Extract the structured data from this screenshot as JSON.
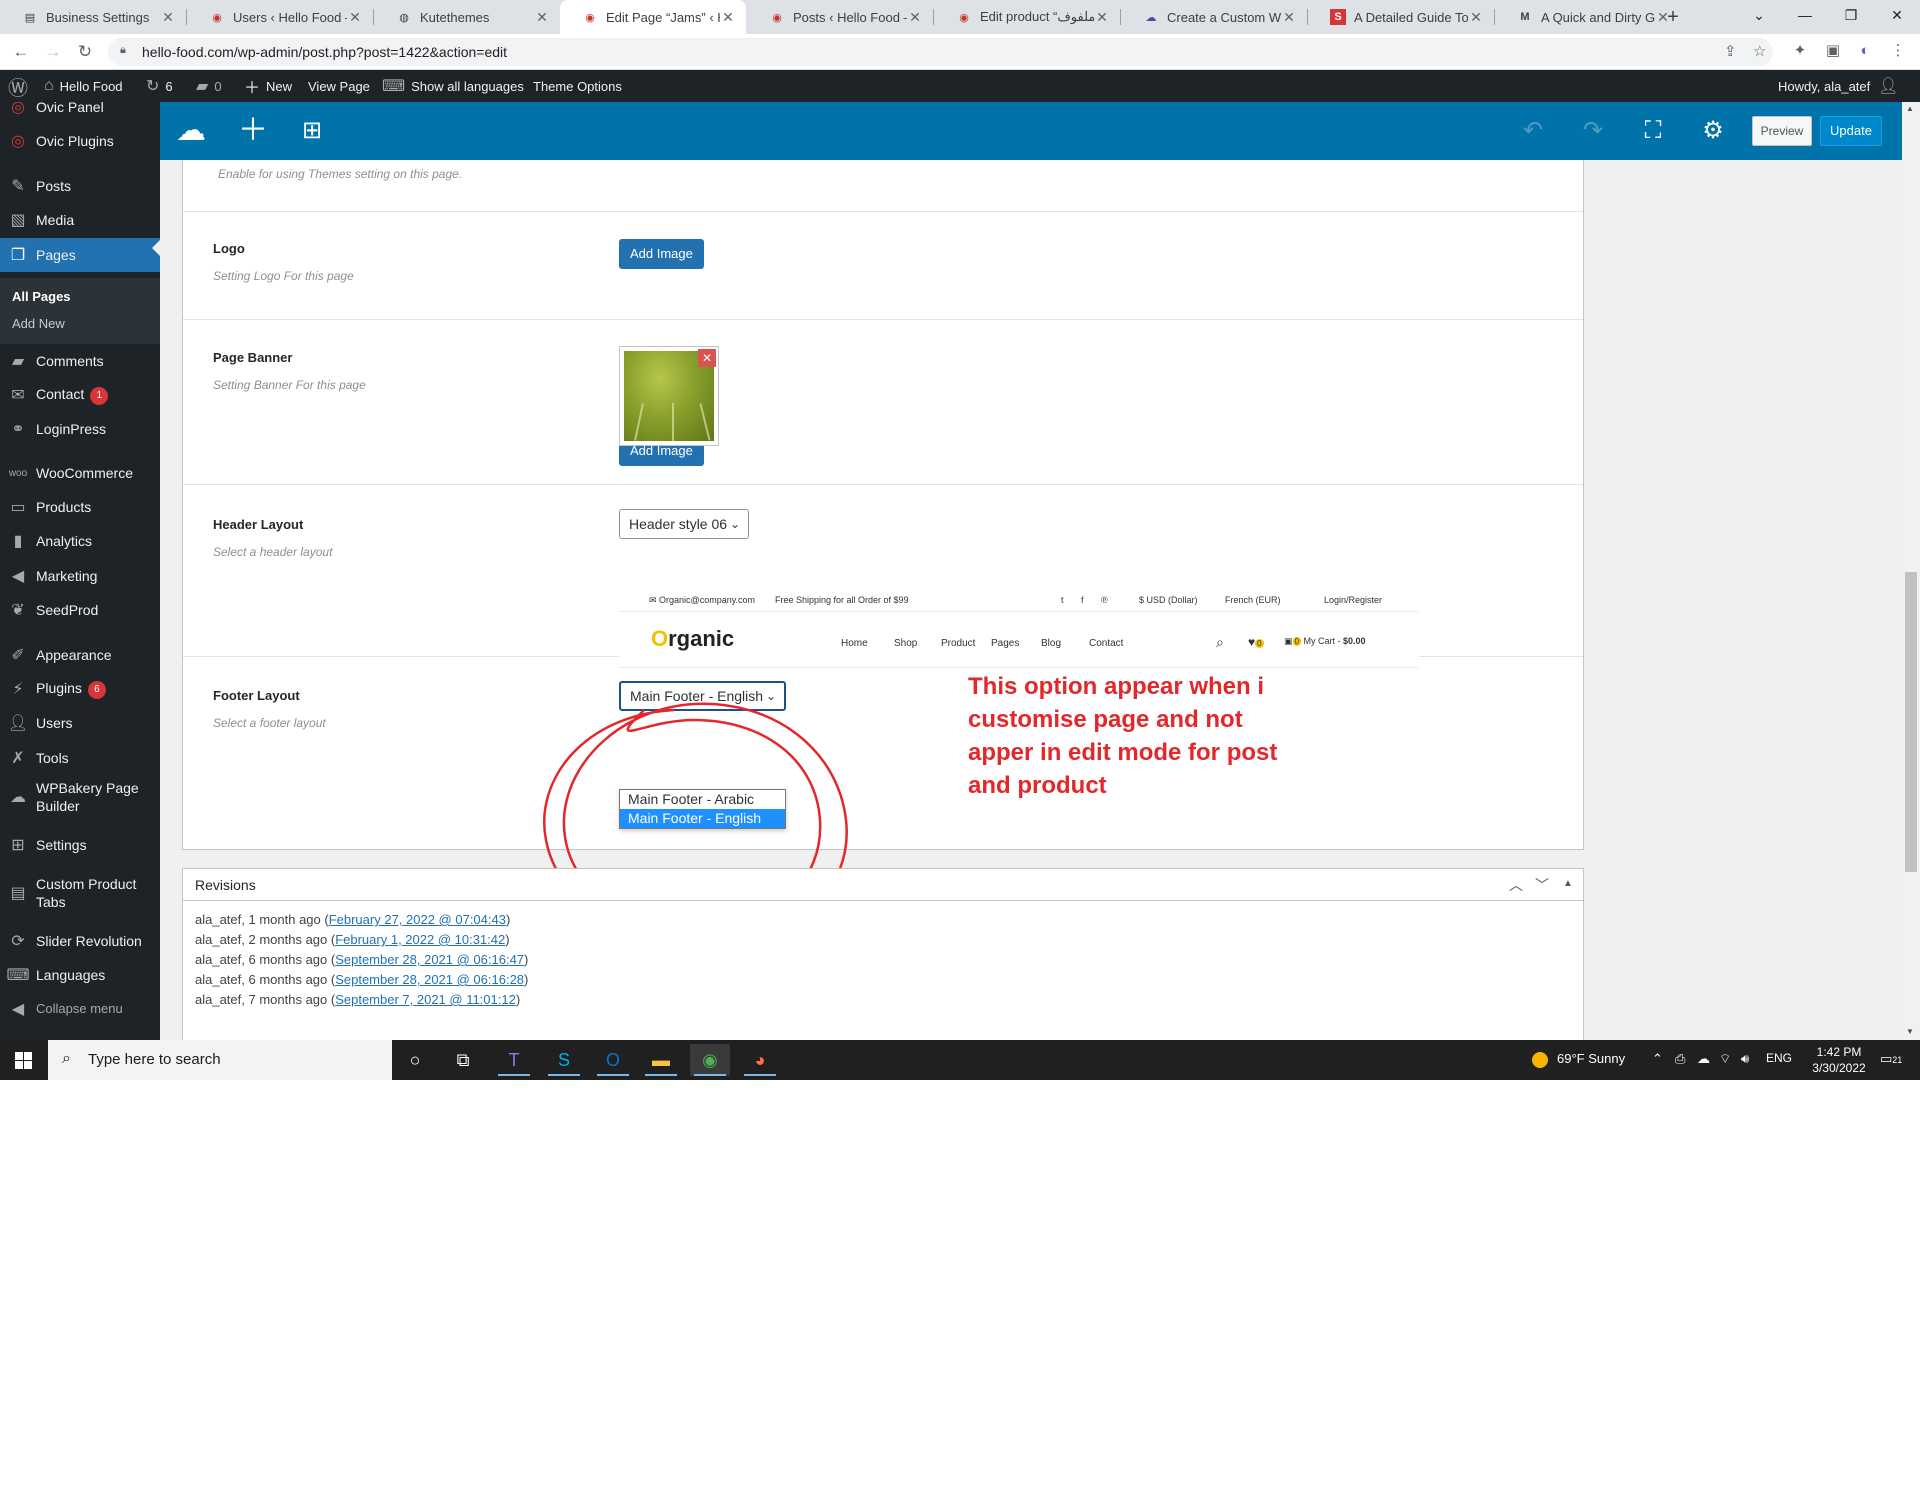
{
  "browser": {
    "tabs": [
      {
        "label": "Business Settings",
        "icon": "business-icon"
      },
      {
        "label": "Users ‹ Hello Food — WordPress",
        "icon": "wp-site-icon"
      },
      {
        "label": "Kutethemes",
        "icon": "globe-icon"
      },
      {
        "label": "Edit Page “Jams” ‹ Hello Food",
        "icon": "wp-site-icon",
        "active": true
      },
      {
        "label": "Posts ‹ Hello Food — WordPress",
        "icon": "wp-site-icon"
      },
      {
        "label": "Edit product “الملفوف”",
        "icon": "wp-site-icon"
      },
      {
        "label": "Create a Custom WordPress",
        "icon": "cloud-icon"
      },
      {
        "label": "A Detailed Guide To A",
        "icon": "s-icon"
      },
      {
        "label": "A Quick and Dirty Guide",
        "icon": "wm-icon"
      }
    ],
    "url": "hello-food.com/wp-admin/post.php?post=1422&action=edit"
  },
  "adminbar": {
    "site_name": "Hello Food",
    "updates": "6",
    "comments": "0",
    "new": "New",
    "view_page": "View Page",
    "languages": "Show all languages",
    "theme_options": "Theme Options",
    "howdy": "Howdy, ala_atef"
  },
  "menu": {
    "items": [
      {
        "label": "Ovic Panel",
        "icon": "ovic-icon"
      },
      {
        "label": "Ovic Plugins",
        "icon": "ovic-icon"
      },
      {
        "label": "Posts",
        "icon": "pin-icon"
      },
      {
        "label": "Media",
        "icon": "media-icon"
      },
      {
        "label": "Pages",
        "icon": "pages-icon"
      },
      {
        "label": "Comments",
        "icon": "comment-icon"
      },
      {
        "label": "Contact",
        "icon": "mail-icon",
        "badge": "1"
      },
      {
        "label": "LoginPress",
        "icon": "loginpress-icon"
      },
      {
        "label": "WooCommerce",
        "icon": "woo-icon"
      },
      {
        "label": "Products",
        "icon": "archive-icon"
      },
      {
        "label": "Analytics",
        "icon": "chart-icon"
      },
      {
        "label": "Marketing",
        "icon": "megaphone-icon"
      },
      {
        "label": "SeedProd",
        "icon": "seed-icon"
      },
      {
        "label": "Appearance",
        "icon": "brush-icon"
      },
      {
        "label": "Plugins",
        "icon": "plugin-icon",
        "badge": "6"
      },
      {
        "label": "Users",
        "icon": "users-icon"
      },
      {
        "label": "Tools",
        "icon": "tools-icon"
      },
      {
        "label": "WPBakery Page Builder",
        "icon": "wpbakery-icon"
      },
      {
        "label": "Settings",
        "icon": "settings-icon"
      },
      {
        "label": "Custom Product Tabs",
        "icon": "tabs-icon"
      },
      {
        "label": "Slider Revolution",
        "icon": "refresh-icon"
      },
      {
        "label": "Languages",
        "icon": "translate-icon"
      },
      {
        "label": "Collapse menu",
        "icon": "collapse-icon"
      }
    ],
    "submenu": {
      "all_pages": "All Pages",
      "add_new": "Add New"
    }
  },
  "toolbar": {
    "preview": "Preview",
    "update": "Update"
  },
  "form": {
    "themes_setting_desc": "Enable for using Themes setting on this page.",
    "logo_label": "Logo",
    "logo_desc": "Setting Logo For this page",
    "add_image": "Add Image",
    "banner_label": "Page Banner",
    "banner_desc": "Setting Banner For this page",
    "header_label": "Header Layout",
    "header_desc": "Select a header layout",
    "header_value": "Header style 06",
    "footer_label": "Footer Layout",
    "footer_desc": "Select a footer layout",
    "footer_value": "Main Footer - English",
    "footer_options": [
      "Main Footer - Arabic",
      "Main Footer - English"
    ]
  },
  "header_preview": {
    "email": "Organic@company.com",
    "shipping": "Free Shipping for all Order of $99",
    "currency": "$ USD (Dollar)",
    "language": "French (EUR)",
    "login": "Login/Register",
    "logo_o": "O",
    "logo_rest": "rganic",
    "nav": [
      "Home",
      "Shop",
      "Product",
      "Pages",
      "Blog",
      "Contact"
    ],
    "wishlist_count": "0",
    "cart_count": "0",
    "cart_label": "My Cart -",
    "cart_total": "$0.00"
  },
  "annotation": "This option appear when i customise page and not apper in edit mode for post and product",
  "revisions": {
    "title": "Revisions",
    "items": [
      {
        "who": "ala_atef, 1 month ago (",
        "date": "February 27, 2022 @ 07:04:43"
      },
      {
        "who": "ala_atef, 2 months ago (",
        "date": "February 1, 2022 @ 10:31:42"
      },
      {
        "who": "ala_atef, 6 months ago (",
        "date": "September 28, 2021 @ 06:16:47"
      },
      {
        "who": "ala_atef, 6 months ago (",
        "date": "September 28, 2021 @ 06:16:28"
      },
      {
        "who": "ala_atef, 7 months ago (",
        "date": "September 7, 2021 @ 11:01:12"
      }
    ]
  },
  "taskbar": {
    "search_placeholder": "Type here to search",
    "weather": "69°F  Sunny",
    "lang": "ENG",
    "time": "1:42 PM",
    "date": "3/30/2022",
    "notifications": "21"
  },
  "colors": {
    "wp_dark": "#1d2327",
    "wp_blue": "#2271b1",
    "vc_blue": "#0073aa",
    "annotation_red": "#e3272b"
  }
}
